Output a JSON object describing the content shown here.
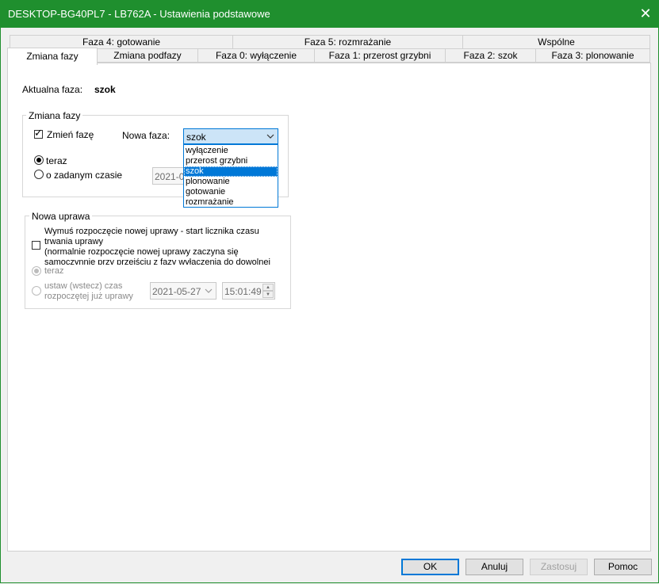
{
  "window": {
    "title": "DESKTOP-BG40PL7 - LB762A - Ustawienia podstawowe",
    "close_glyph": "✕",
    "accent_color": "#1f8f2e"
  },
  "tabs_row1": [
    "Faza 4: gotowanie",
    "Faza 5: rozmrażanie",
    "Wspólne"
  ],
  "tabs_row2": [
    "Zmiana fazy",
    "Zmiana podfazy",
    "Faza 0: wyłączenie",
    "Faza 1: przerost grzybni",
    "Faza 2: szok",
    "Faza 3: plonowanie"
  ],
  "current_phase": {
    "label": "Aktualna faza:",
    "value": "szok"
  },
  "change_group": {
    "legend": "Zmiana fazy",
    "checkbox_label": "Zmień fazę",
    "checkbox_checked": true,
    "new_phase_label": "Nowa faza:",
    "select_value": "szok",
    "options": [
      "wyłączenie",
      "przerost grzybni",
      "szok",
      "plonowanie",
      "gotowanie",
      "rozmrażanie"
    ],
    "selected_option": "szok",
    "radio_now": "teraz",
    "radio_scheduled": "o zadanym czasie",
    "date_partial": "2021-05"
  },
  "new_crop_group": {
    "legend": "Nowa uprawa",
    "force_text_1": "Wymuś rozpoczęcie nowej uprawy - start licznika czasu trwania uprawy",
    "force_text_2": "(normalnie rozpoczęcie nowej uprawy zaczyna się samoczynnie przy przejściu z fazy wyłączenia do dowolnej innej fazy)",
    "radio_now": "teraz",
    "radio_set_back_1": "ustaw (wstecz) czas",
    "radio_set_back_2": "rozpoczętej już uprawy",
    "date": "2021-05-27",
    "time": "15:01:49"
  },
  "buttons": {
    "ok": "OK",
    "cancel": "Anuluj",
    "apply": "Zastosuj",
    "help": "Pomoc"
  }
}
